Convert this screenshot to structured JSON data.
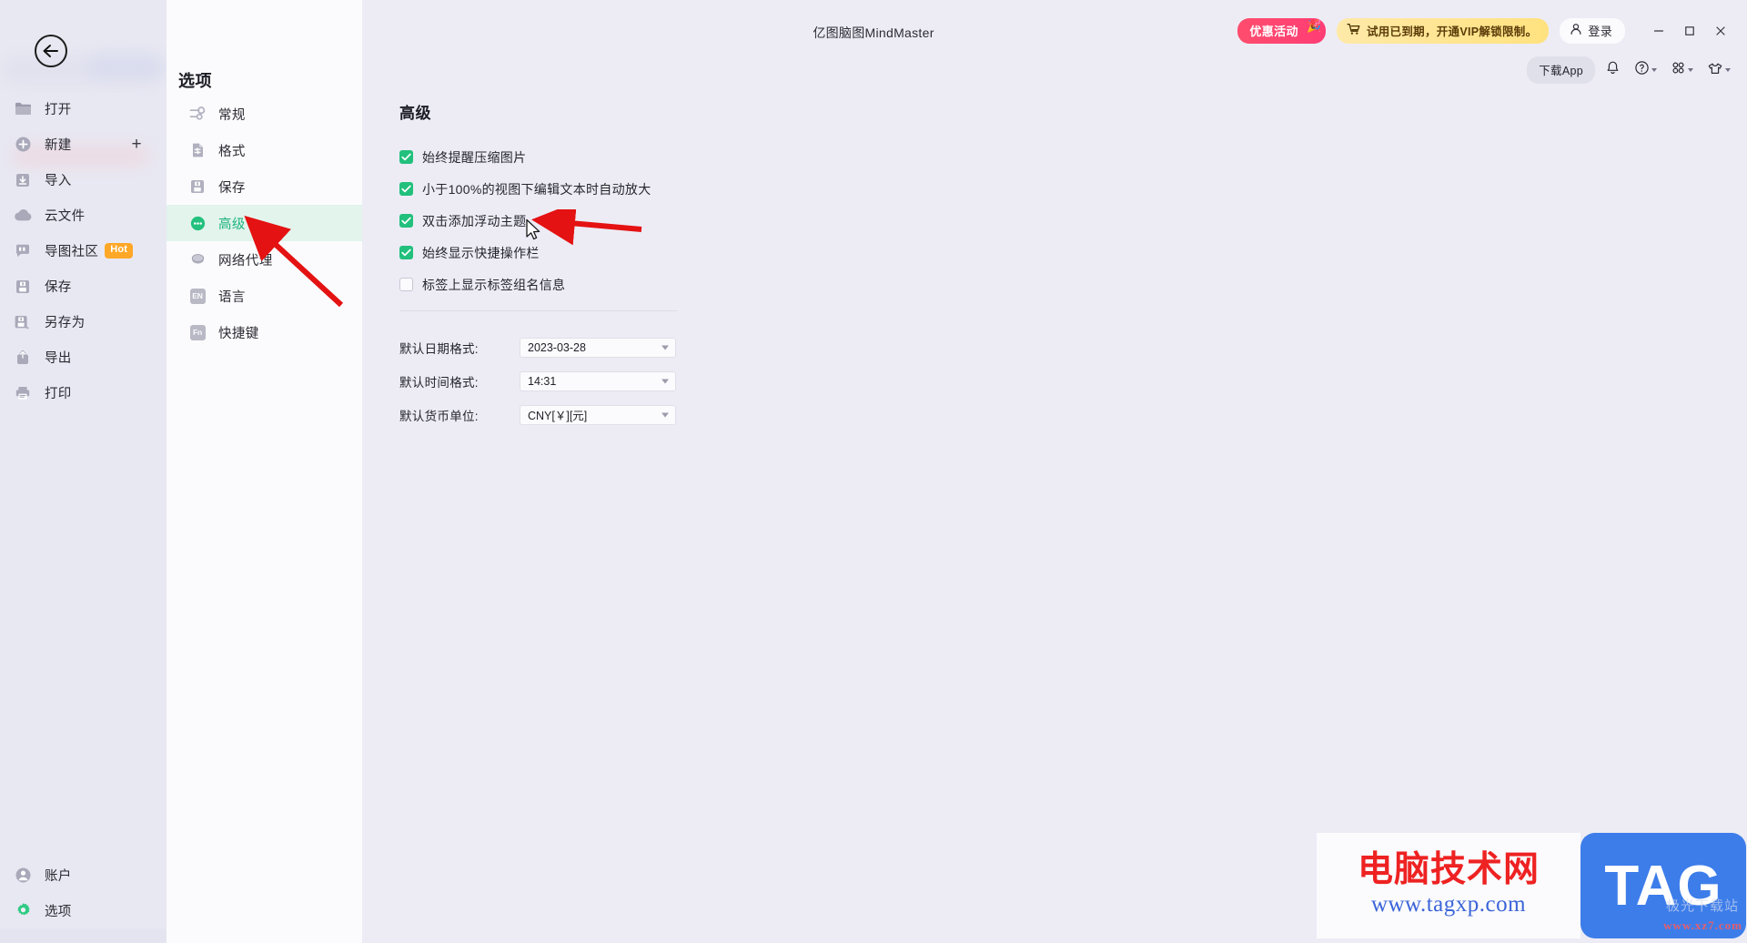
{
  "window": {
    "title": "亿图脑图MindMaster",
    "controls": {
      "minimize": "—",
      "maximize": "□",
      "close": "✕"
    }
  },
  "topbar": {
    "promo_label": "优惠活动",
    "vip_label": "试用已到期，开通VIP解锁限制。",
    "login_label": "登录",
    "download_app_label": "下载App",
    "accent_promo": "#ff4063",
    "accent_vip": "#ffe27f"
  },
  "sidebar": {
    "items": [
      {
        "label": "打开",
        "icon": "folder-icon"
      },
      {
        "label": "新建",
        "icon": "plus-circle-icon",
        "trailing": "+"
      },
      {
        "label": "导入",
        "icon": "import-icon"
      },
      {
        "label": "云文件",
        "icon": "cloud-icon"
      },
      {
        "label": "导图社区",
        "icon": "community-icon",
        "badge": "Hot"
      },
      {
        "label": "保存",
        "icon": "save-icon"
      },
      {
        "label": "另存为",
        "icon": "save-as-icon"
      },
      {
        "label": "导出",
        "icon": "export-icon"
      },
      {
        "label": "打印",
        "icon": "print-icon"
      }
    ],
    "bottom_items": [
      {
        "label": "账户",
        "icon": "account-icon"
      },
      {
        "label": "选项",
        "icon": "gear-icon",
        "active": true
      }
    ]
  },
  "options_panel": {
    "title": "选项",
    "items": [
      {
        "label": "常规",
        "icon": "sliders-icon",
        "active": false
      },
      {
        "label": "格式",
        "icon": "format-icon",
        "active": false
      },
      {
        "label": "保存",
        "icon": "save-icon",
        "active": false
      },
      {
        "label": "高级",
        "icon": "advanced-icon",
        "active": true
      },
      {
        "label": "网络代理",
        "icon": "network-icon",
        "active": false
      },
      {
        "label": "语言",
        "icon": "language-icon",
        "active": false,
        "glyph": "EN"
      },
      {
        "label": "快捷键",
        "icon": "hotkey-icon",
        "active": false,
        "glyph": "Fn"
      }
    ],
    "active_color": "#1cb47c",
    "active_bg": "#e2f4ec"
  },
  "content": {
    "title": "高级",
    "checkboxes": [
      {
        "label": "始终提醒压缩图片",
        "checked": true
      },
      {
        "label": "小于100%的视图下编辑文本时自动放大",
        "checked": true
      },
      {
        "label": "双击添加浮动主题",
        "checked": true
      },
      {
        "label": "始终显示快捷操作栏",
        "checked": true
      },
      {
        "label": "标签上显示标签组名信息",
        "checked": false
      }
    ],
    "checkbox_color": "#22c07c",
    "fields": [
      {
        "label": "默认日期格式:",
        "value": "2023-03-28"
      },
      {
        "label": "默认时间格式:",
        "value": "14:31"
      },
      {
        "label": "默认货币单位:",
        "value": "CNY[￥][元]"
      }
    ]
  },
  "watermark": {
    "cn": "电脑技术网",
    "url": "www.tagxp.com",
    "tag": "TAG",
    "sub": "www.xz7.com",
    "sub2": "极光下载站"
  }
}
